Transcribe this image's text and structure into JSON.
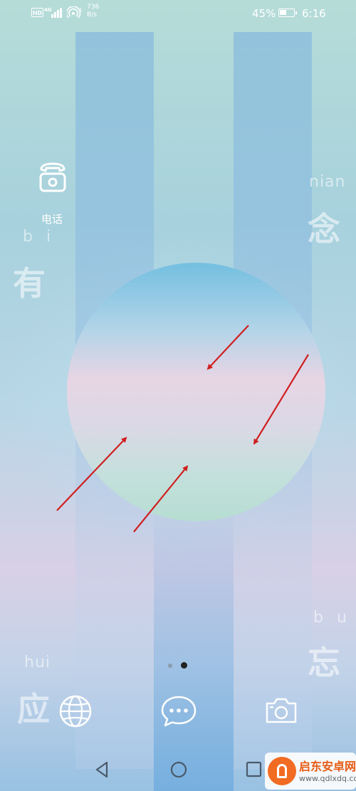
{
  "status_bar": {
    "hd_label": "HD",
    "network_type": "4G",
    "speed_value": "736",
    "speed_unit": "B/s",
    "battery_percent": "45%",
    "battery_level": 0.45,
    "time": "6:16"
  },
  "home": {
    "apps": [
      {
        "label": "电话",
        "icon": "phone-icon"
      }
    ],
    "wallpaper_text": [
      {
        "pinyin": "b i",
        "hanzi": "有"
      },
      {
        "pinyin": "nian",
        "hanzi": "念"
      },
      {
        "pinyin": "hui",
        "hanzi": "应"
      },
      {
        "pinyin": "b u",
        "hanzi": "忘"
      }
    ],
    "page_indicator": {
      "pages": 2,
      "current": 2
    }
  },
  "dock": {
    "items": [
      {
        "icon": "browser-globe-icon"
      },
      {
        "icon": "messages-icon"
      },
      {
        "icon": "camera-icon"
      }
    ]
  },
  "nav_bar": {
    "buttons": [
      {
        "icon": "back-triangle-icon"
      },
      {
        "icon": "home-circle-icon"
      },
      {
        "icon": "recents-square-icon"
      }
    ]
  },
  "watermark": {
    "title": "启东安卓网",
    "url": "www.qdlxdq.com"
  },
  "colors": {
    "annotation_arrow": "#d02020",
    "sky_top": "#b6dcd8",
    "sun_top": "#74bfe0",
    "watermark_orange": "#f26b22"
  }
}
